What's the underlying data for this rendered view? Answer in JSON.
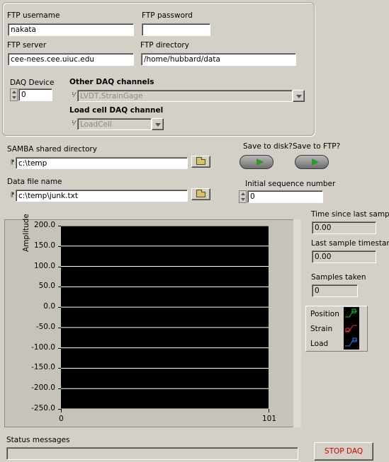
{
  "ftp": {
    "username_label": "FTP username",
    "username_value": "nakata",
    "password_label": "FTP password",
    "password_value": "",
    "server_label": "FTP server",
    "server_value": "cee-nees.cee.uiuc.edu",
    "directory_label": "FTP directory",
    "directory_value": "/home/hubbard/data"
  },
  "daq": {
    "device_label": "DAQ Device",
    "device_value": "0",
    "other_channels_label": "Other DAQ channels",
    "other_channels_value": "LVDT,StrainGage",
    "loadcell_label": "Load cell DAQ channel",
    "loadcell_value": "LoadCell"
  },
  "samba": {
    "label": "SAMBA shared directory",
    "value": "c:\\temp"
  },
  "datafile": {
    "label": "Data file name",
    "value": "c:\\temp\\junk.txt"
  },
  "save": {
    "disk_label": "Save to disk?",
    "ftp_label": "Save to FTP?"
  },
  "sequence": {
    "label": "Initial sequence number",
    "value": "0"
  },
  "stats": {
    "time_since_label": "Time since last sample",
    "time_since_value": "0.00",
    "last_ts_label": "Last sample timestamp",
    "last_ts_value": "0.00",
    "samples_label": "Samples taken",
    "samples_value": "0"
  },
  "legend": [
    {
      "name": "Position",
      "color": "#22bb44"
    },
    {
      "name": "Strain",
      "color": "#dd3333"
    },
    {
      "name": "Load",
      "color": "#3377ee"
    }
  ],
  "status": {
    "label": "Status messages",
    "value": ""
  },
  "stop_button": "STOP DAQ",
  "colors": {
    "panel_bg": "#d4d0c8",
    "plot_bg": "#000000",
    "gridline": "#ffffff",
    "led_green": "#2a9a2a",
    "stop_text": "#d40000"
  },
  "chart_data": {
    "type": "line",
    "title": "",
    "xlabel": "",
    "ylabel": "Amplitude",
    "xlim": [
      0,
      101
    ],
    "ylim": [
      -250,
      200
    ],
    "x_ticks": [
      "0",
      "101"
    ],
    "y_ticks": [
      "200.0",
      "150.0",
      "100.0",
      "50.0",
      "0.0",
      "-50.0",
      "-100.0",
      "-150.0",
      "-200.0",
      "-250.0"
    ],
    "grid": true,
    "legend_placement": "right",
    "series": [
      {
        "name": "Position",
        "values": []
      },
      {
        "name": "Strain",
        "values": []
      },
      {
        "name": "Load",
        "values": []
      }
    ]
  }
}
